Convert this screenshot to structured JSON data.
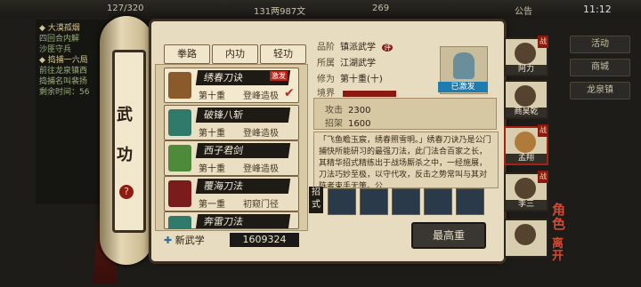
{
  "hud": {
    "stamina": "127/320",
    "money": "131两987文",
    "gold": "269",
    "notice": "公告",
    "time": "11:12"
  },
  "log": {
    "lines": [
      "◆ 大漠孤烟",
      "四回合内解",
      "沙匪守兵",
      "◆ 捣捕一六局",
      "前往龙泉镇西",
      "捣捕名叫裴扬",
      "剩余时间：56"
    ]
  },
  "right_menu": [
    "活动",
    "商城",
    "龙泉镇"
  ],
  "scroll": {
    "title_top": "武",
    "title_bottom": "功",
    "help": "?"
  },
  "tabs": [
    "拳路",
    "内功",
    "轻功"
  ],
  "skills": [
    {
      "name": "绣春刀诀",
      "level": "第十重",
      "rank": "登峰造极",
      "badge": "激发",
      "checked": true
    },
    {
      "name": "破锋八斩",
      "level": "第十重",
      "rank": "登峰造极"
    },
    {
      "name": "西子君剑",
      "level": "第十重",
      "rank": "登峰造极"
    },
    {
      "name": "覆海刀法",
      "level": "第一重",
      "rank": "初窥门径"
    },
    {
      "name": "奔雷刀法",
      "level": "",
      "rank": ""
    }
  ],
  "new_skill_label": "新武学",
  "skill_points": "1609324",
  "detail": {
    "grade_label": "品阶",
    "grade_value": "镇派武学",
    "faction_label": "所属",
    "faction_value": "江湖武学",
    "cult_label": "修为",
    "cult_value": "第十重(十)",
    "realm_label": "境界",
    "activated": "已激发",
    "attack_label": "攻击",
    "attack_value": "2300",
    "parry_label": "招架",
    "parry_value": "1600",
    "description": "「飞鱼瞻玉宸，绣春照雪明。」绣春刀诀乃是公门捕快所能研习的最强刀法，此门法合百家之长，其精华招式精练出于战场厮杀之中，一经施展，刀法巧妙至极，以守代攻，反击之势常叫与其对阵者束手无策。公",
    "moves_label": "招式",
    "max_button": "最高重"
  },
  "characters": [
    {
      "name": "阿力",
      "tag": "战"
    },
    {
      "name": "商昊乾",
      "tag": ""
    },
    {
      "name": "孟翔",
      "tag": "战"
    },
    {
      "name": "李三",
      "tag": "战"
    },
    {
      "name": "",
      "tag": ""
    }
  ],
  "role_label": "角色",
  "leave_label": "离开",
  "colors": {
    "panel": "#e8dcc0",
    "dark": "#1e1a16",
    "accent": "#8a1a10",
    "activated": "#1f7cb0"
  }
}
